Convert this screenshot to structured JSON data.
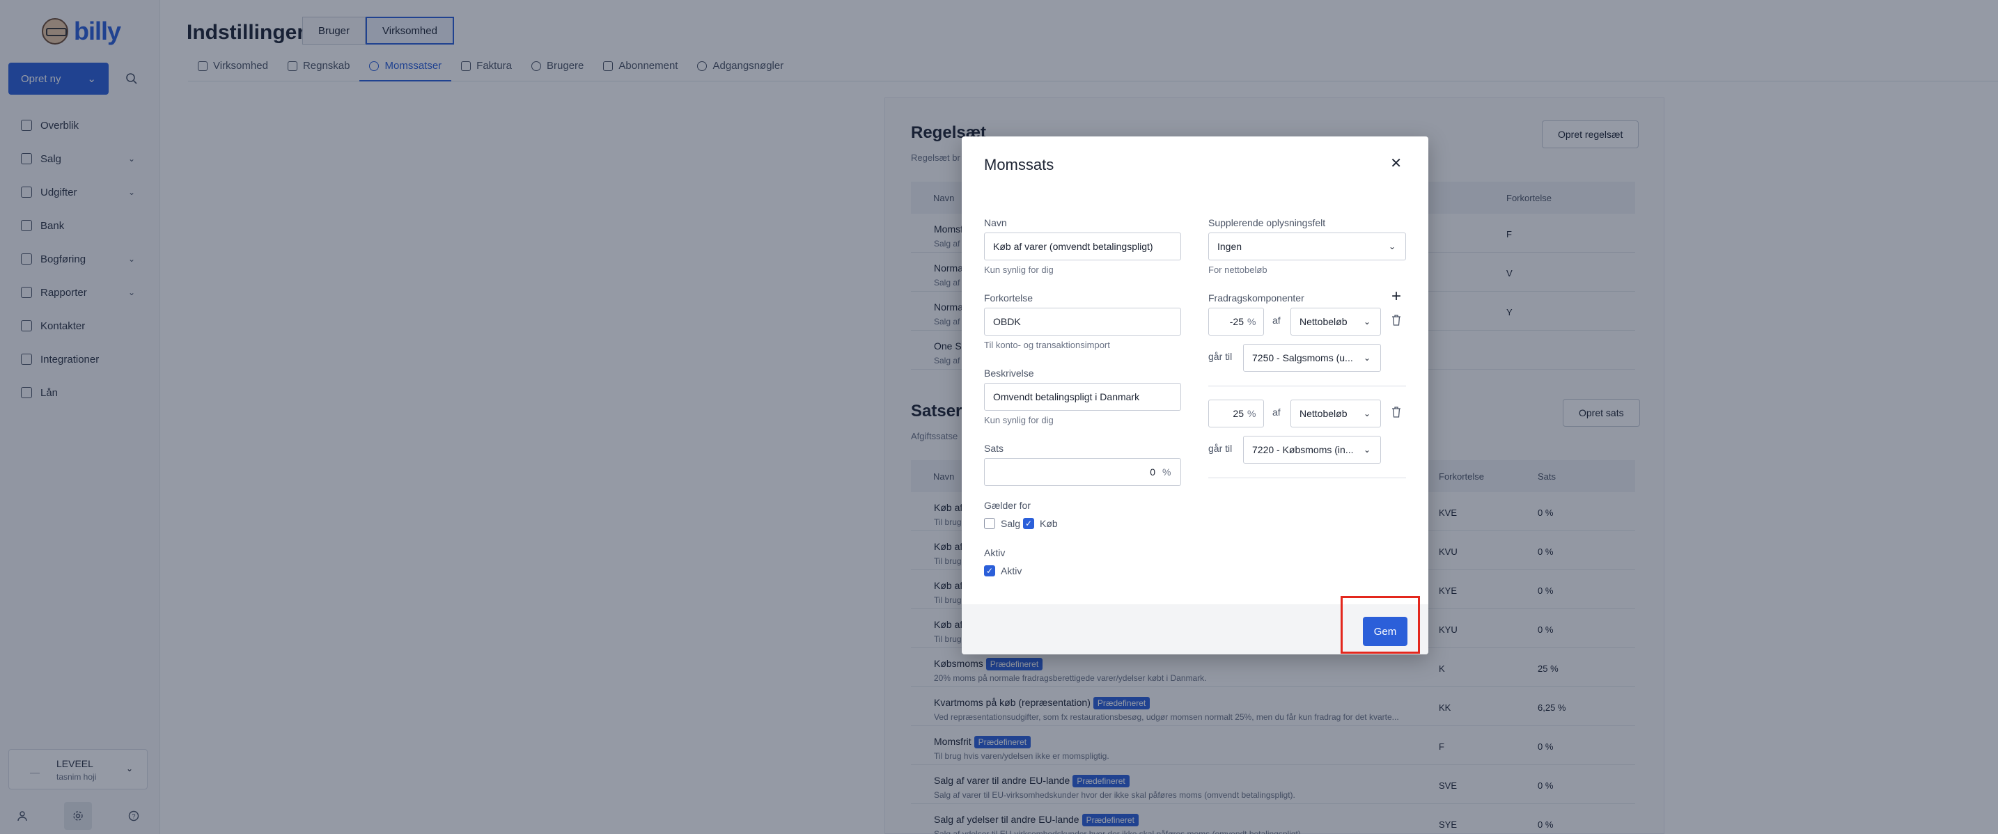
{
  "brand": {
    "name": "billy"
  },
  "sidebar": {
    "create_label": "Opret ny",
    "items": [
      {
        "label": "Overblik",
        "has_chevron": false
      },
      {
        "label": "Salg",
        "has_chevron": true
      },
      {
        "label": "Udgifter",
        "has_chevron": true
      },
      {
        "label": "Bank",
        "has_chevron": false
      },
      {
        "label": "Bogføring",
        "has_chevron": true
      },
      {
        "label": "Rapporter",
        "has_chevron": true
      },
      {
        "label": "Kontakter",
        "has_chevron": false
      },
      {
        "label": "Integrationer",
        "has_chevron": false
      },
      {
        "label": "Lån",
        "has_chevron": false
      }
    ],
    "org": {
      "dash": "—",
      "name": "LEVEEL",
      "user": "tasnim hoji"
    }
  },
  "header": {
    "title": "Indstillinger",
    "toggle": [
      "Bruger",
      "Virksomhed"
    ],
    "tabs": [
      "Virksomhed",
      "Regnskab",
      "Momssatser",
      "Faktura",
      "Brugere",
      "Abonnement",
      "Adgangsnøgler"
    ]
  },
  "ruleset": {
    "title": "Regelsæt",
    "subtitle": "Regelsæt br",
    "button": "Opret regelsæt",
    "col_name": "Navn",
    "col_abbr": "Forkortelse",
    "rows": [
      {
        "name": "Momsf",
        "desc": "Salg af",
        "abbr": "F"
      },
      {
        "name": "Norma",
        "desc": "Salg af",
        "abbr": "V"
      },
      {
        "name": "Norma",
        "desc": "Salg af",
        "abbr": "Y"
      },
      {
        "name": "One St",
        "desc": "Salg af",
        "abbr": ""
      }
    ]
  },
  "rates": {
    "title": "Satser",
    "subtitle": "Afgiftssatse",
    "button": "Opret sats",
    "col_name": "Navn",
    "col_abbr": "Forkortelse",
    "col_rate": "Sats",
    "badge": "Prædefineret",
    "rows": [
      {
        "name": "Køb af",
        "desc": "Til brug",
        "abbr": "KVE",
        "rate": "0 %",
        "badge": false
      },
      {
        "name": "Køb af",
        "desc": "Til brug",
        "abbr": "KVU",
        "rate": "0 %",
        "badge": false
      },
      {
        "name": "Køb af",
        "desc": "Til brug",
        "abbr": "KYE",
        "rate": "0 %",
        "badge": false
      },
      {
        "name": "Køb af",
        "desc": "Til brug",
        "abbr": "KYU",
        "rate": "0 %",
        "badge": false
      },
      {
        "name": "Købsmoms",
        "desc": "20% moms på normale fradragsberettigede varer/ydelser købt i Danmark.",
        "abbr": "K",
        "rate": "25 %",
        "badge": true
      },
      {
        "name": "Kvartmoms på køb (repræsentation)",
        "desc": "Ved repræsentationsudgifter, som fx restaurationsbesøg, udgør momsen normalt 25%, men du får kun fradrag for det kvarte...",
        "abbr": "KK",
        "rate": "6,25 %",
        "badge": true
      },
      {
        "name": "Momsfrit",
        "desc": "Til brug hvis varen/ydelsen ikke er momspligtig.",
        "abbr": "F",
        "rate": "0 %",
        "badge": true
      },
      {
        "name": "Salg af varer til andre EU-lande",
        "desc": "Salg af varer til EU-virksomhedskunder hvor der ikke skal påføres moms (omvendt betalingspligt).",
        "abbr": "SVE",
        "rate": "0 %",
        "badge": true
      },
      {
        "name": "Salg af ydelser til andre EU-lande",
        "desc": "Salg af ydelser til EU-virksomhedskunder hvor der ikke skal påføres moms (omvendt betalingspligt).",
        "abbr": "SYE",
        "rate": "0 %",
        "badge": true
      }
    ]
  },
  "modal": {
    "title": "Momssats",
    "name_label": "Navn",
    "name_value": "Køb af varer (omvendt betalingspligt)",
    "name_hint": "Kun synlig for dig",
    "abbr_label": "Forkortelse",
    "abbr_value": "OBDK",
    "abbr_hint": "Til konto- og transaktionsimport",
    "desc_label": "Beskrivelse",
    "desc_value": "Omvendt betalingspligt i Danmark",
    "desc_hint": "Kun synlig for dig",
    "rate_label": "Sats",
    "rate_value": "0",
    "rate_unit": "%",
    "applies_label": "Gælder for",
    "applies_sales": "Salg",
    "applies_sales_checked": false,
    "applies_purchase": "Køb",
    "applies_purchase_checked": true,
    "active_label": "Aktiv",
    "active_checkbox_label": "Aktiv",
    "active_checked": true,
    "extra_label": "Supplerende oplysningsfelt",
    "extra_value": "Ingen",
    "extra_hint": "For nettobeløb",
    "components_label": "Fradragskomponenter",
    "of_label": "af",
    "goes_to_label": "går til",
    "components": [
      {
        "percent": "-25",
        "unit": "%",
        "base": "Nettobeløb",
        "account": "7250 - Salgsmoms (u..."
      },
      {
        "percent": "25",
        "unit": "%",
        "base": "Nettobeløb",
        "account": "7220 - Købsmoms (in..."
      }
    ],
    "save_label": "Gem"
  },
  "colors": {
    "accent": "#2b5fd9",
    "highlight": "#e3271d"
  }
}
